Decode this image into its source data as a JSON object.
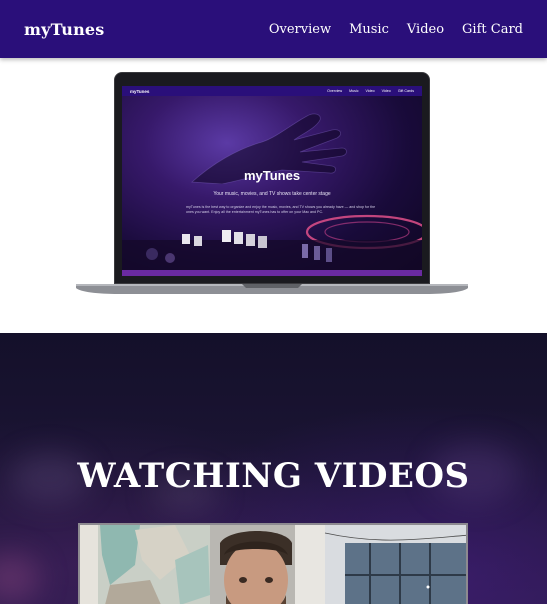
{
  "header": {
    "brand": "myTunes",
    "nav": [
      {
        "label": "Overview"
      },
      {
        "label": "Music"
      },
      {
        "label": "Video"
      },
      {
        "label": "Gift Card"
      }
    ]
  },
  "laptop_screen": {
    "brand": "myTunes",
    "nav": [
      "Overview",
      "Music",
      "Video",
      "Video",
      "Gift Cards"
    ],
    "title": "myTunes",
    "subtitle": "Your music, movies, and TV shows take center stage",
    "body": "myTunes is the best way to organize and enjoy the music, movies, and TV shows you already have — and shop for the ones you want. Enjoy all the entertainment myTunes has to offer on your Mac and PC."
  },
  "videos_section": {
    "heading": "WATCHING VIDEOS"
  },
  "colors": {
    "header_bg": "#2a0f7a",
    "dark_section_bg": "#1c1535"
  }
}
